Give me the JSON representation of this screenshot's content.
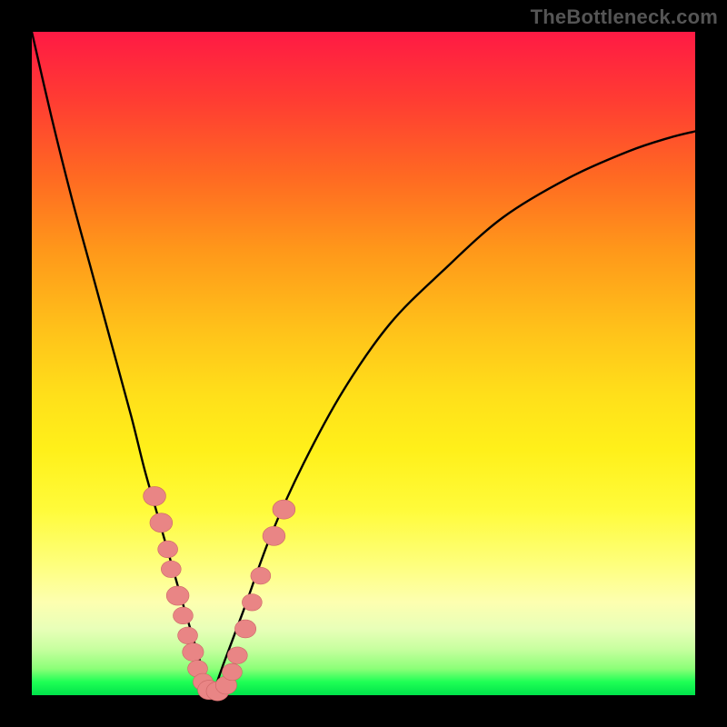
{
  "attribution": "TheBottleneck.com",
  "colors": {
    "frame": "#000000",
    "curve": "#000000",
    "marker_fill": "#e98585",
    "marker_stroke": "#c66",
    "gradient_stops": [
      "#ff1a44",
      "#ff3b33",
      "#ff6a22",
      "#ff981a",
      "#ffc21a",
      "#ffe01a",
      "#fff01a",
      "#fffb3a",
      "#feff7a",
      "#fdffb0",
      "#e8ffb8",
      "#c8ffa0",
      "#8cff78",
      "#1eff55",
      "#00e24a"
    ]
  },
  "chart_data": {
    "type": "line",
    "title": "",
    "xlabel": "",
    "ylabel": "",
    "xlim": [
      0,
      100
    ],
    "ylim": [
      0,
      100
    ],
    "x_min_at": 27,
    "curve_left": {
      "x": [
        0,
        3,
        6,
        9,
        12,
        15,
        17,
        19,
        21,
        23,
        24.5,
        26,
        27
      ],
      "y": [
        100,
        87,
        75,
        64,
        53,
        42,
        34,
        27,
        20,
        13,
        8,
        3,
        0
      ]
    },
    "curve_right": {
      "x": [
        27,
        29,
        32,
        36,
        41,
        47,
        54,
        62,
        71,
        81,
        90,
        96,
        100
      ],
      "y": [
        0,
        5,
        13,
        24,
        35,
        46,
        56,
        64,
        72,
        78,
        82,
        84,
        85
      ]
    },
    "series": [
      {
        "name": "curve",
        "x": [
          0,
          3,
          6,
          9,
          12,
          15,
          17,
          19,
          21,
          23,
          24.5,
          26,
          27,
          29,
          32,
          36,
          41,
          47,
          54,
          62,
          71,
          81,
          90,
          96,
          100
        ],
        "y": [
          100,
          87,
          75,
          64,
          53,
          42,
          34,
          27,
          20,
          13,
          8,
          3,
          0,
          5,
          13,
          24,
          35,
          46,
          56,
          64,
          72,
          78,
          82,
          84,
          85
        ]
      }
    ],
    "markers": {
      "name": "highlighted-points",
      "points": [
        {
          "x": 18.5,
          "y": 30,
          "r": 1.7
        },
        {
          "x": 19.5,
          "y": 26,
          "r": 1.7
        },
        {
          "x": 20.5,
          "y": 22,
          "r": 1.5
        },
        {
          "x": 21.0,
          "y": 19,
          "r": 1.5
        },
        {
          "x": 22.0,
          "y": 15,
          "r": 1.7
        },
        {
          "x": 22.8,
          "y": 12,
          "r": 1.5
        },
        {
          "x": 23.5,
          "y": 9,
          "r": 1.5
        },
        {
          "x": 24.3,
          "y": 6.5,
          "r": 1.6
        },
        {
          "x": 25.0,
          "y": 4,
          "r": 1.5
        },
        {
          "x": 25.8,
          "y": 2,
          "r": 1.5
        },
        {
          "x": 26.7,
          "y": 0.8,
          "r": 1.7
        },
        {
          "x": 28.0,
          "y": 0.6,
          "r": 1.7
        },
        {
          "x": 29.3,
          "y": 1.5,
          "r": 1.6
        },
        {
          "x": 30.2,
          "y": 3.5,
          "r": 1.5
        },
        {
          "x": 31.0,
          "y": 6,
          "r": 1.5
        },
        {
          "x": 32.2,
          "y": 10,
          "r": 1.6
        },
        {
          "x": 33.2,
          "y": 14,
          "r": 1.5
        },
        {
          "x": 34.5,
          "y": 18,
          "r": 1.5
        },
        {
          "x": 36.5,
          "y": 24,
          "r": 1.7
        },
        {
          "x": 38.0,
          "y": 28,
          "r": 1.7
        }
      ]
    }
  }
}
